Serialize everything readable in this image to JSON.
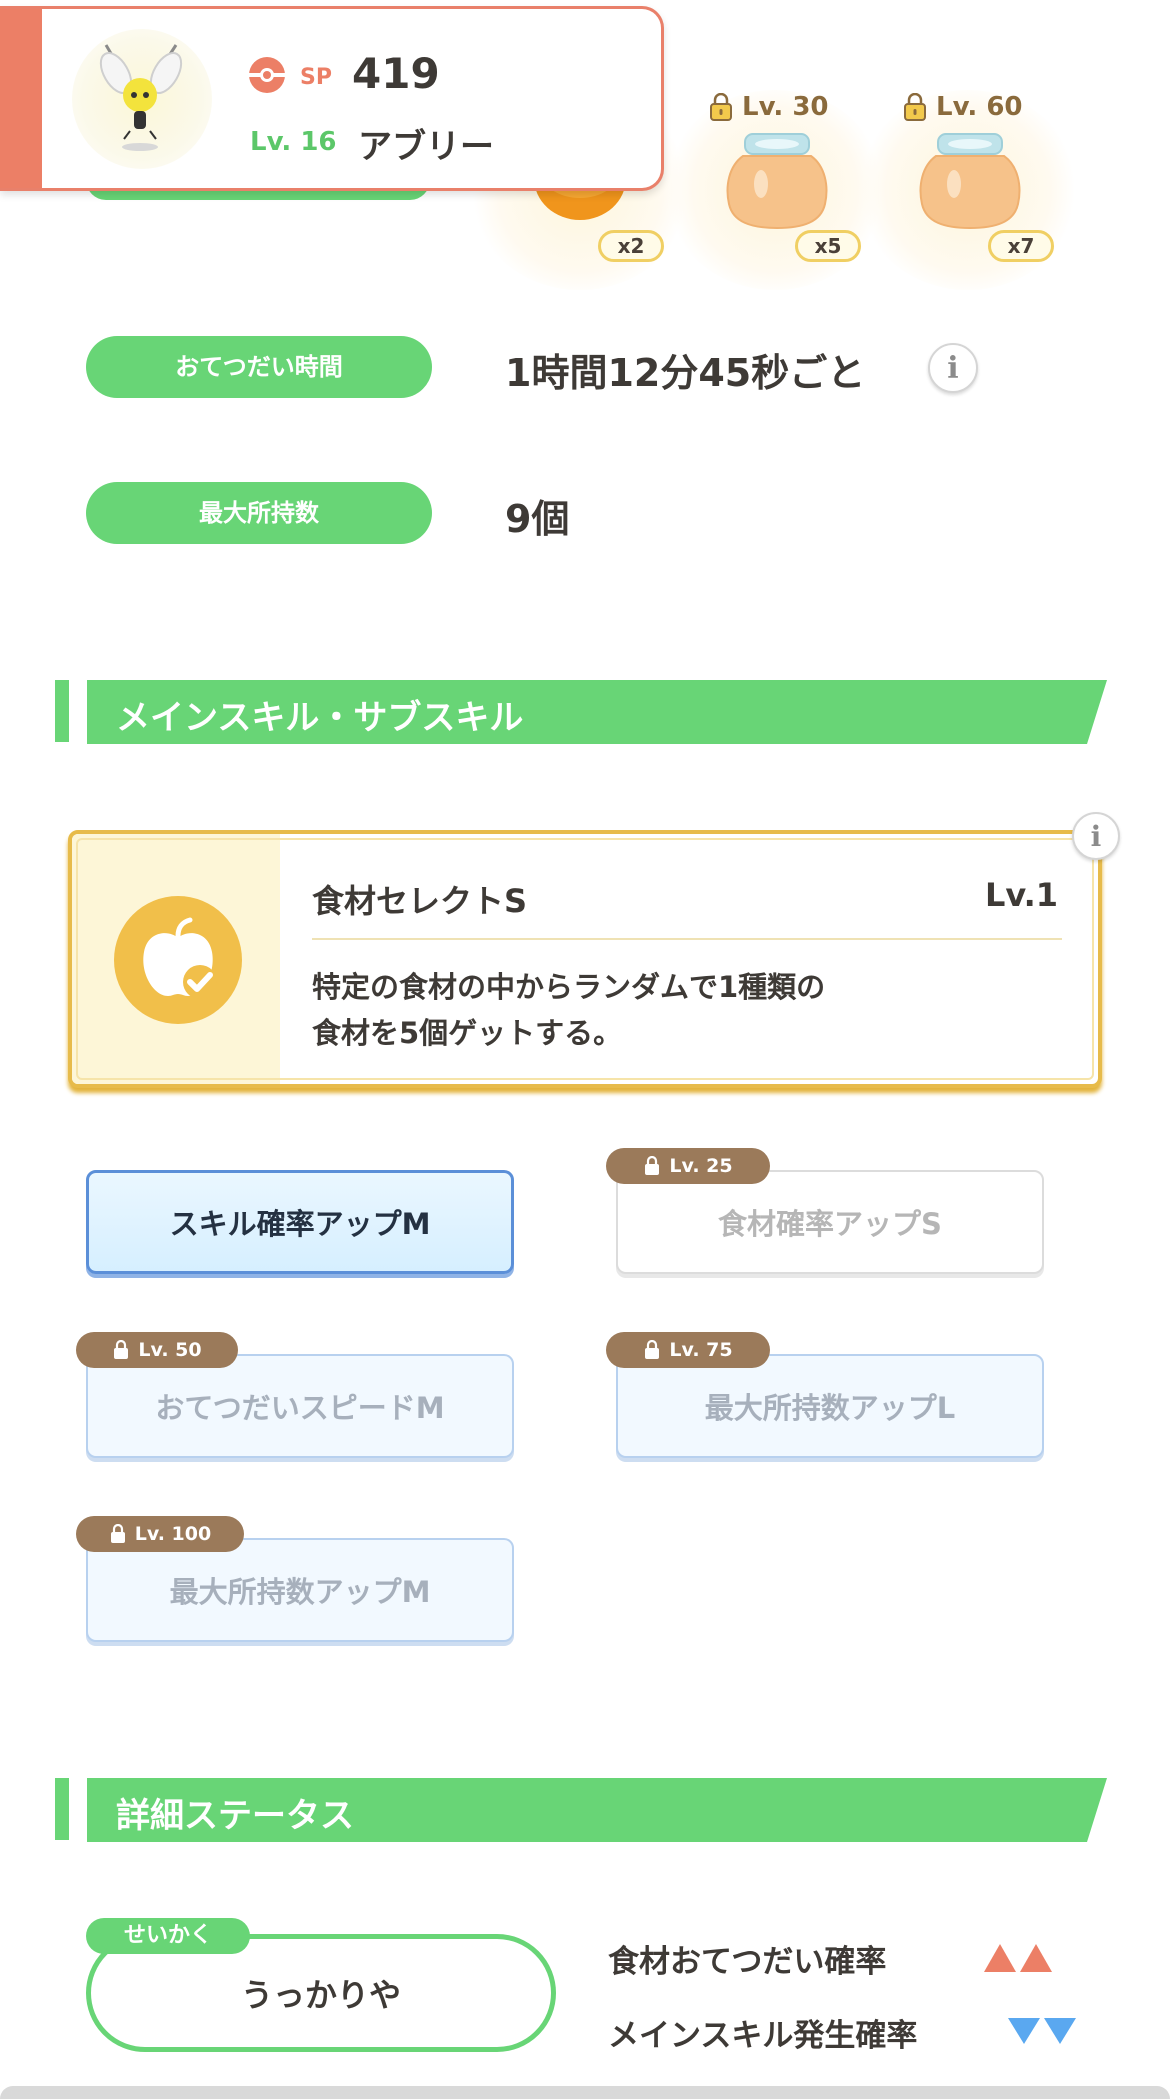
{
  "header": {
    "sp_label": "SP",
    "sp_value": "419",
    "level_label": "Lv. 16",
    "pokemon_name": "アブリー"
  },
  "ingredients": {
    "slots": [
      {
        "count": "x2",
        "locked": false
      },
      {
        "lock_label": "Lv. 30",
        "count": "x5",
        "locked": true
      },
      {
        "lock_label": "Lv. 60",
        "count": "x7",
        "locked": true
      }
    ]
  },
  "stats": {
    "help_time_label": "おてつだい時間",
    "help_time_value": "1時間12分45秒ごと",
    "max_carry_label": "最大所持数",
    "max_carry_value": "9個"
  },
  "skills_section": {
    "title": "メインスキル・サブスキル",
    "main_skill": {
      "name": "食材セレクトS",
      "level": "Lv.1",
      "description_line1": "特定の食材の中からランダムで1種類の",
      "description_line2": "食材を5個ゲットする。"
    },
    "sub_skills": [
      {
        "name": "スキル確率アップM",
        "lock": "",
        "state": "active"
      },
      {
        "name": "食材確率アップS",
        "lock": "Lv. 25",
        "state": "locked-white"
      },
      {
        "name": "おてつだいスピードM",
        "lock": "Lv. 50",
        "state": "locked"
      },
      {
        "name": "最大所持数アップL",
        "lock": "Lv. 75",
        "state": "locked"
      },
      {
        "name": "最大所持数アップM",
        "lock": "Lv. 100",
        "state": "locked"
      }
    ]
  },
  "details_section": {
    "title": "詳細ステータス",
    "nature_tag": "せいかく",
    "nature_value": "うっかりや",
    "effect_up_label": "食材おてつだい確率",
    "effect_down_label": "メインスキル発生確率",
    "up_color": "#ec7f66",
    "down_color": "#5aa8f0"
  },
  "icons": [
    "sp-icon",
    "lock-icon",
    "info-icon",
    "apple-check-icon",
    "honey-jar-icon",
    "triangle-up-icon",
    "triangle-down-icon"
  ]
}
